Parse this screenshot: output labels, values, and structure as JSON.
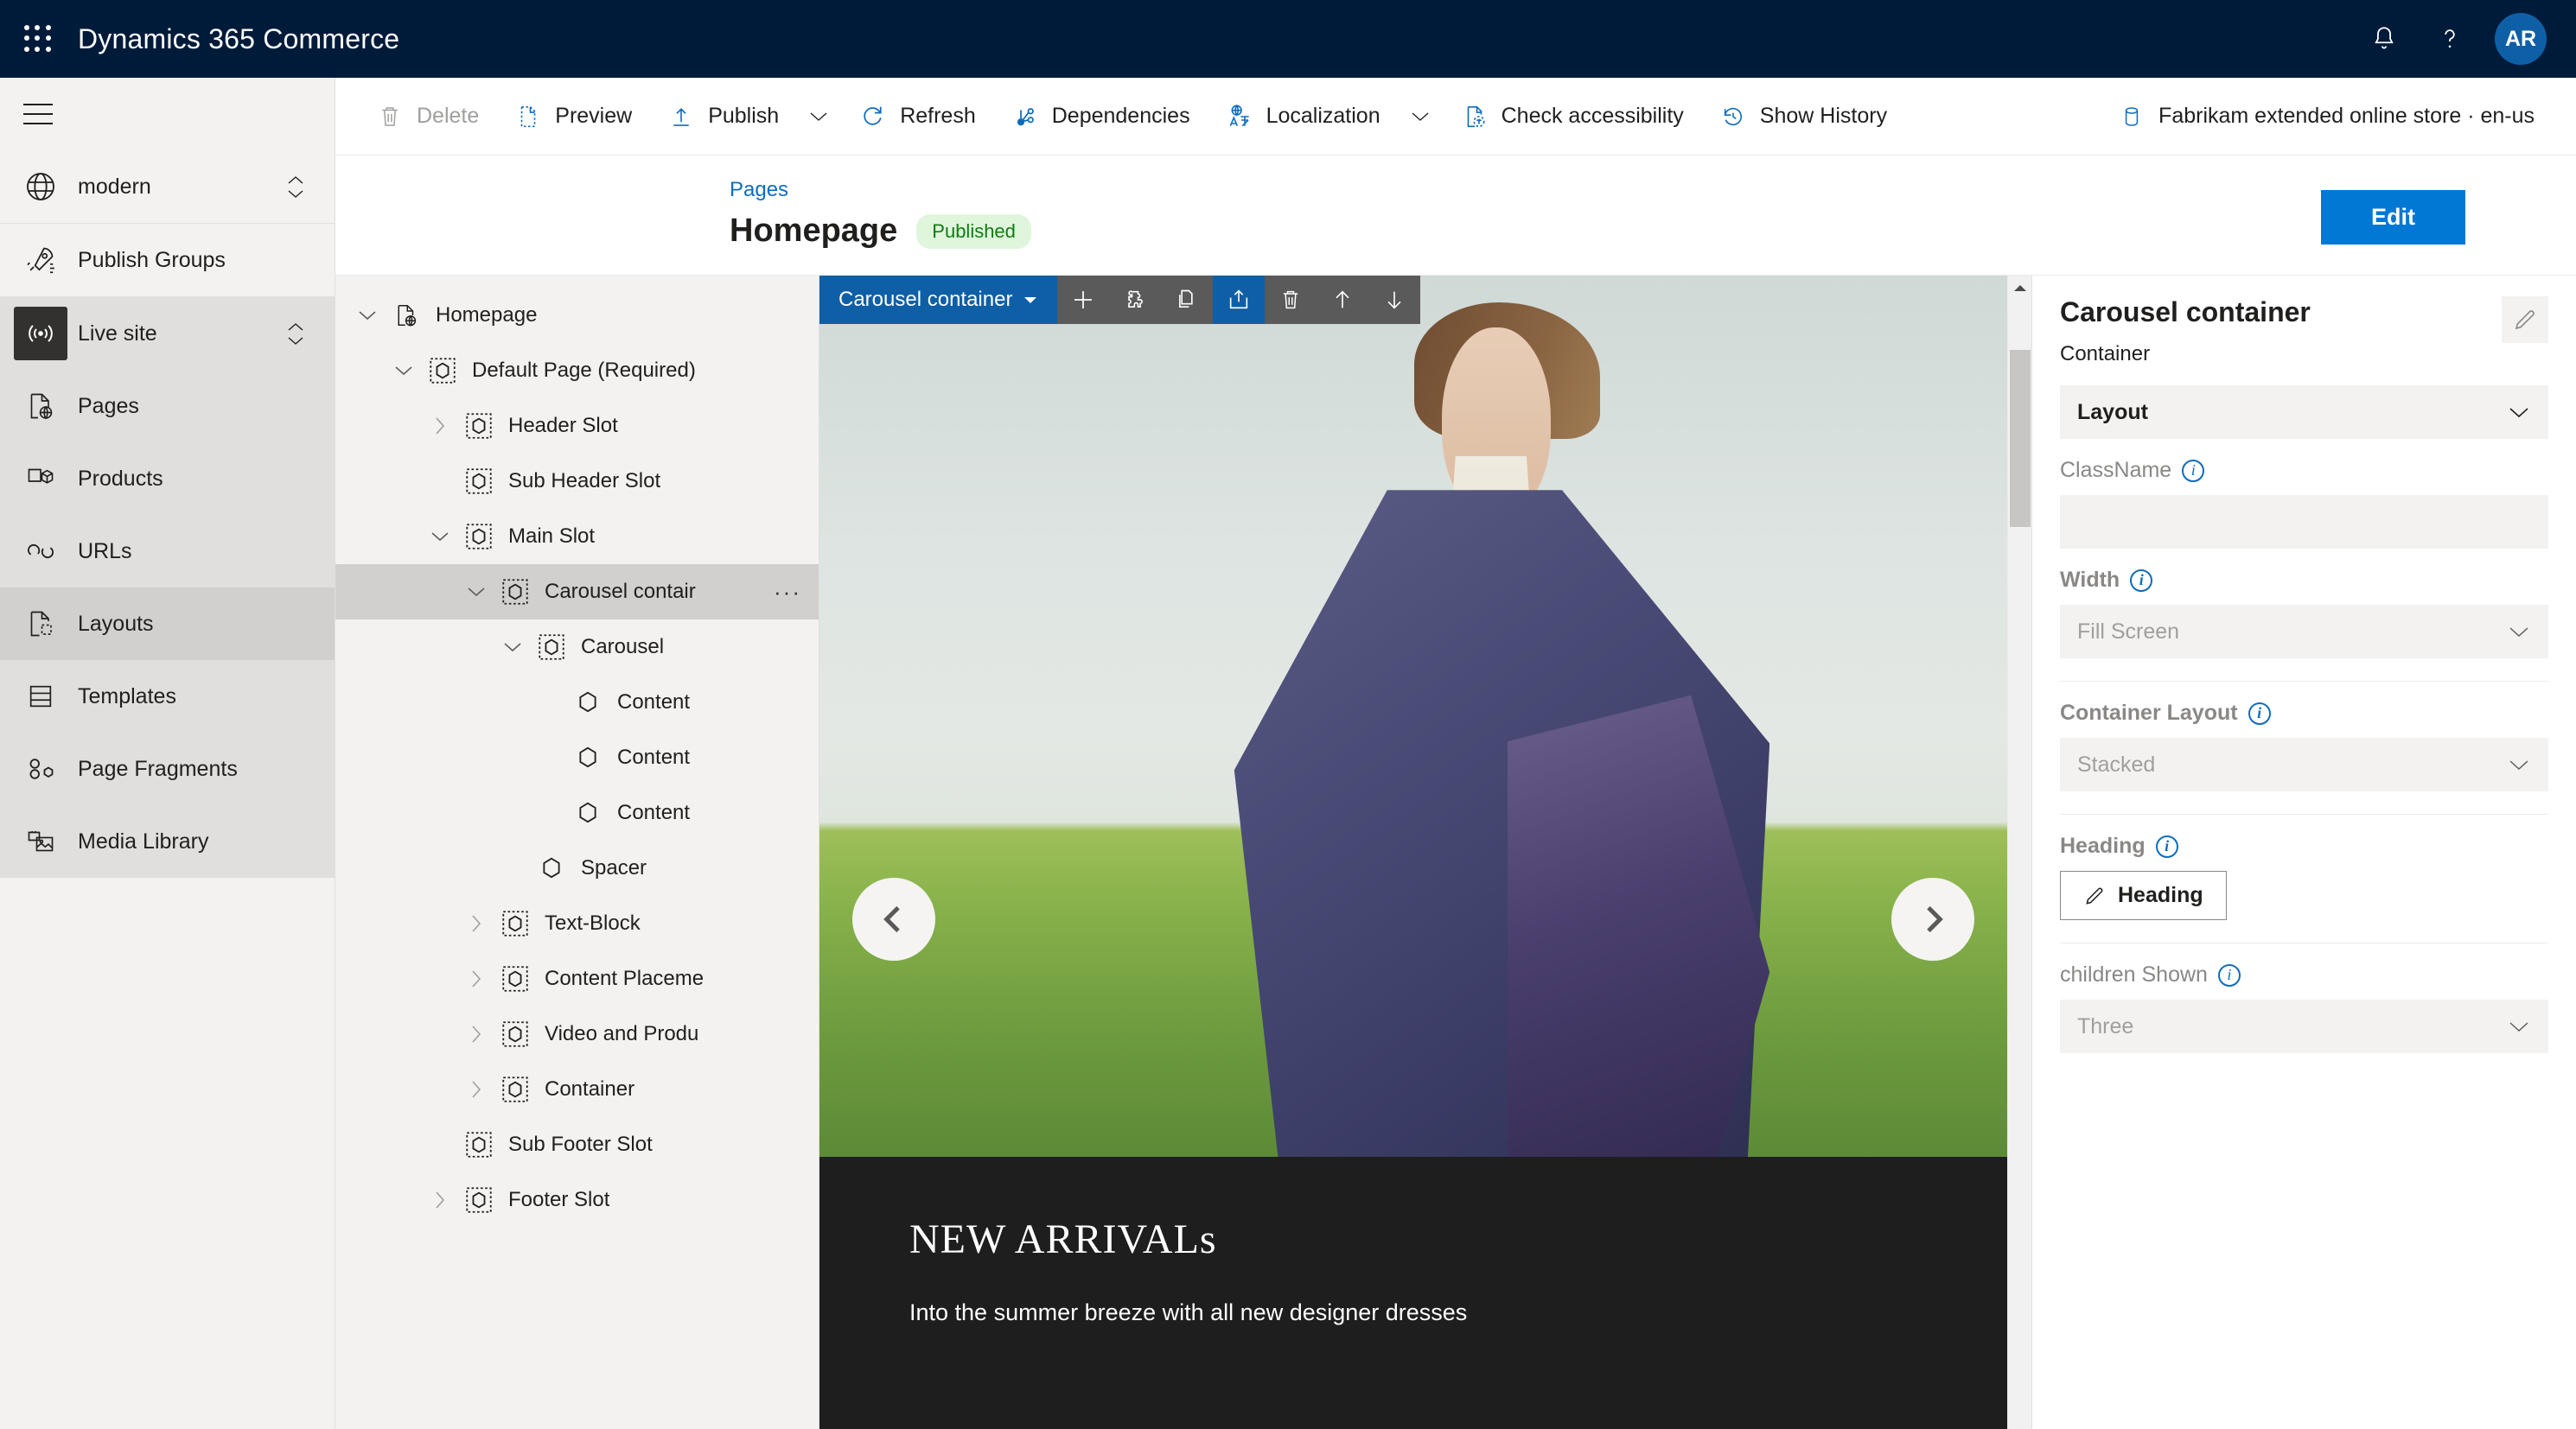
{
  "topbar": {
    "waffle_icon": "waffle-grid-icon",
    "app_title": "Dynamics 365 Commerce",
    "notification_icon": "bell-icon",
    "help_icon": "question-mark-icon",
    "avatar_initials": "AR",
    "accent_blue": "#0078D4",
    "header_bg": "#001B3A"
  },
  "sidebar": {
    "menu_icon": "hamburger-icon",
    "site_selector": {
      "label": "modern",
      "icon": "globe-icon"
    },
    "items": [
      {
        "label": "Publish Groups",
        "icon": "rocket-icon"
      },
      {
        "label": "Live site",
        "icon": "broadcast-icon"
      },
      {
        "label": "Pages",
        "icon": "page-globe-icon"
      },
      {
        "label": "Products",
        "icon": "product-box-icon"
      },
      {
        "label": "URLs",
        "icon": "link-icon"
      },
      {
        "label": "Layouts",
        "icon": "layout-icon"
      },
      {
        "label": "Templates",
        "icon": "template-icon"
      },
      {
        "label": "Page Fragments",
        "icon": "fragments-icon"
      },
      {
        "label": "Media Library",
        "icon": "media-image-icon"
      }
    ]
  },
  "commandbar": {
    "delete": {
      "label": "Delete",
      "icon": "trash-icon",
      "disabled": true
    },
    "preview": {
      "label": "Preview",
      "icon": "page-dashed-icon"
    },
    "publish": {
      "label": "Publish",
      "icon": "upload-arrow-icon"
    },
    "publish_chevron": "chevron-down-icon",
    "refresh": {
      "label": "Refresh",
      "icon": "refresh-circle-icon"
    },
    "dependencies": {
      "label": "Dependencies",
      "icon": "branch-icon"
    },
    "localization": {
      "label": "Localization",
      "icon": "globe-translate-icon"
    },
    "localization_chevron": "chevron-down-icon",
    "check_accessibility": {
      "label": "Check accessibility",
      "icon": "page-accessibility-icon"
    },
    "show_history": {
      "label": "Show History",
      "icon": "history-clock-icon"
    },
    "channel": {
      "label": "Fabrikam extended online store · en-us",
      "icon": "database-icon"
    }
  },
  "page": {
    "breadcrumb": "Pages",
    "title": "Homepage",
    "status_badge": "Published",
    "status_badge_color": "#107C10",
    "status_badge_bg": "#DFF6DD",
    "edit_button": "Edit"
  },
  "tree": {
    "nodes": [
      {
        "label": "Homepage",
        "depth": 0,
        "chevron": "down",
        "icon": "page-globe-icon",
        "selected": false
      },
      {
        "label": "Default Page (Required)",
        "depth": 1,
        "chevron": "down",
        "icon": "module-dashed-icon",
        "selected": false
      },
      {
        "label": "Header Slot",
        "depth": 2,
        "chevron": "right",
        "icon": "module-dashed-icon",
        "selected": false
      },
      {
        "label": "Sub Header Slot",
        "depth": 2,
        "chevron": "none",
        "icon": "module-dashed-icon",
        "selected": false
      },
      {
        "label": "Main Slot",
        "depth": 2,
        "chevron": "down",
        "icon": "module-dashed-icon",
        "selected": false
      },
      {
        "label": "Carousel contair",
        "depth": 3,
        "chevron": "down",
        "icon": "module-dashed-icon",
        "selected": true,
        "overflow": "…"
      },
      {
        "label": "Carousel",
        "depth": 4,
        "chevron": "down",
        "icon": "module-dashed-icon",
        "selected": false
      },
      {
        "label": "Content",
        "depth": 5,
        "chevron": "none",
        "icon": "module-solid-icon",
        "selected": false
      },
      {
        "label": "Content",
        "depth": 5,
        "chevron": "none",
        "icon": "module-solid-icon",
        "selected": false
      },
      {
        "label": "Content",
        "depth": 5,
        "chevron": "none",
        "icon": "module-solid-icon",
        "selected": false
      },
      {
        "label": "Spacer",
        "depth": 4,
        "chevron": "none",
        "icon": "module-solid-icon",
        "selected": false
      },
      {
        "label": "Text-Block",
        "depth": 3,
        "chevron": "right",
        "icon": "module-dashed-icon",
        "selected": false
      },
      {
        "label": "Content Placeme",
        "depth": 3,
        "chevron": "right",
        "icon": "module-dashed-icon",
        "selected": false
      },
      {
        "label": "Video and Produ",
        "depth": 3,
        "chevron": "right",
        "icon": "module-dashed-icon",
        "selected": false
      },
      {
        "label": "Container",
        "depth": 3,
        "chevron": "right",
        "icon": "module-dashed-icon",
        "selected": false
      },
      {
        "label": "Sub Footer Slot",
        "depth": 2,
        "chevron": "none",
        "icon": "module-dashed-icon",
        "selected": false
      },
      {
        "label": "Footer Slot",
        "depth": 2,
        "chevron": "right",
        "icon": "module-dashed-icon",
        "selected": false
      }
    ]
  },
  "canvas": {
    "module_toolbar": {
      "label": "Carousel container",
      "label_chevron": "chevron-down-icon",
      "buttons": [
        {
          "name": "add-module-button",
          "icon": "plus-icon",
          "active": false
        },
        {
          "name": "module-settings-button",
          "icon": "puzzle-icon",
          "active": false
        },
        {
          "name": "copy-module-button",
          "icon": "copy-icon",
          "active": false
        },
        {
          "name": "share-module-button",
          "icon": "share-icon",
          "active": true
        },
        {
          "name": "delete-module-button",
          "icon": "trash-icon",
          "active": false
        },
        {
          "name": "move-up-button",
          "icon": "arrow-up-icon",
          "active": false
        },
        {
          "name": "move-down-button",
          "icon": "arrow-down-icon",
          "active": false
        }
      ]
    },
    "carousel": {
      "prev_icon": "chevron-left-icon",
      "next_icon": "chevron-right-icon",
      "caption_title": "NEW ARRIVALs",
      "caption_subtitle": "Into the summer breeze with all new designer dresses",
      "caption_bg": "#1E1E1E"
    },
    "scrollbar": {
      "up_icon": "caret-up-icon"
    }
  },
  "properties": {
    "title": "Carousel container",
    "subtitle": "Container",
    "edit_icon": "pencil-icon",
    "section": {
      "label": "Layout",
      "chevron": "chevron-down-icon"
    },
    "fields": [
      {
        "label": "ClassName",
        "type": "input",
        "value": "",
        "info": "info-icon"
      },
      {
        "label": "Width",
        "type": "select",
        "value": "Fill Screen",
        "info": "info-icon"
      },
      {
        "label": "Container Layout",
        "type": "select",
        "value": "Stacked",
        "info": "info-icon"
      },
      {
        "label": "Heading",
        "type": "button",
        "value": "Heading",
        "info": "info-icon",
        "button_icon": "pencil-icon"
      },
      {
        "label": "children Shown",
        "type": "select",
        "value": "Three",
        "info": "info-icon"
      }
    ]
  }
}
